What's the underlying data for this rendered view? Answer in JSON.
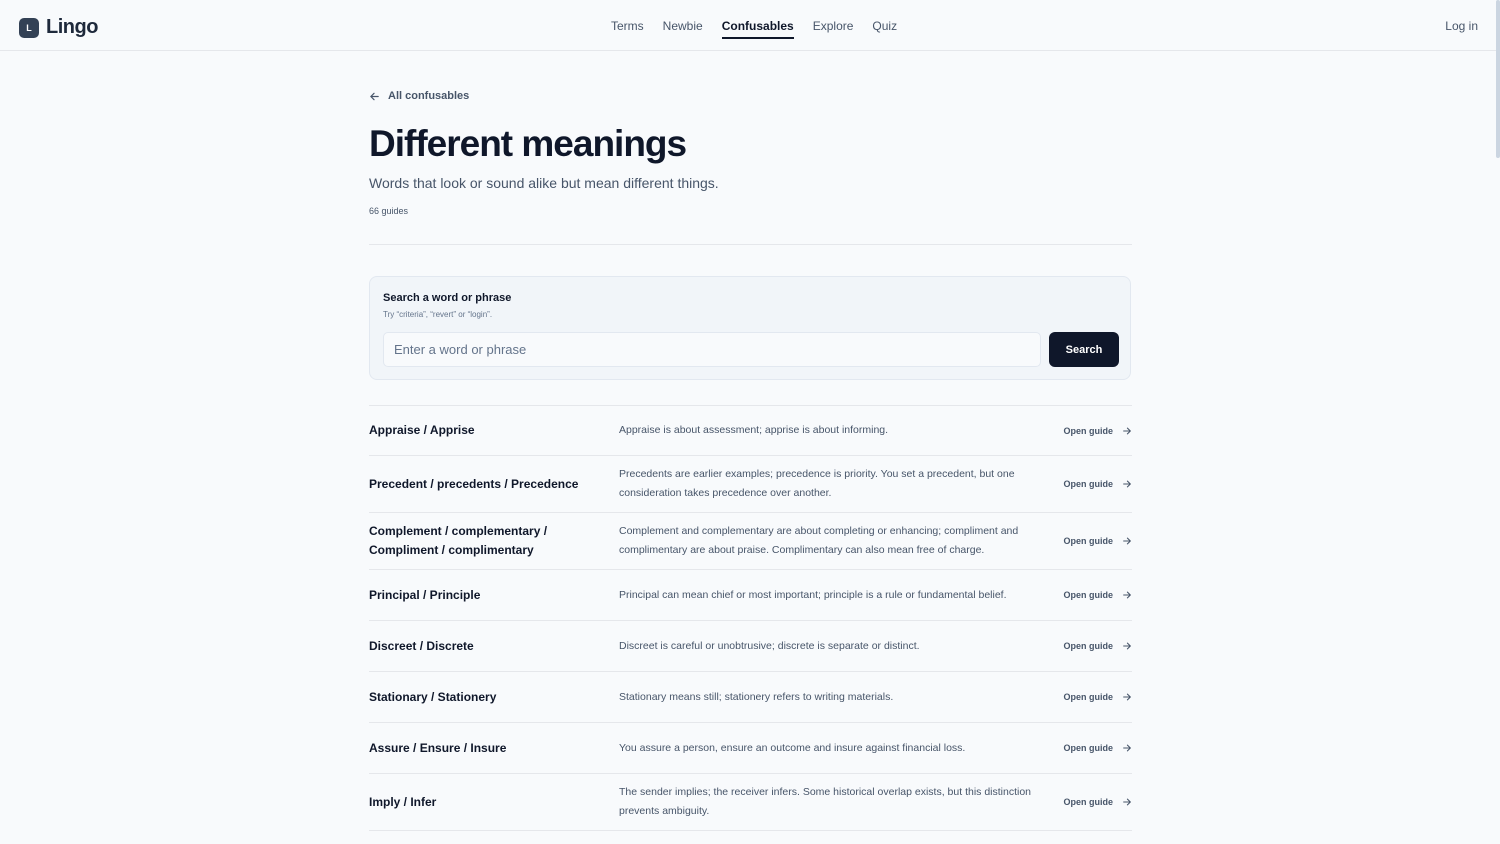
{
  "app": {
    "brand_letter": "L",
    "brand_name": "Lingo"
  },
  "nav": {
    "items": [
      {
        "label": "Terms",
        "active": false
      },
      {
        "label": "Newbie",
        "active": false
      },
      {
        "label": "Confusables",
        "active": true
      },
      {
        "label": "Explore",
        "active": false
      },
      {
        "label": "Quiz",
        "active": false
      }
    ],
    "login": "Log in"
  },
  "page": {
    "back_label": "All confusables",
    "title": "Different meanings",
    "subtitle": "Words that look or sound alike but mean different things.",
    "count": "66 guides"
  },
  "search": {
    "label": "Search a word or phrase",
    "hint": "Try “criteria”, “revert” or “login”.",
    "placeholder": "Enter a word or phrase",
    "value": "",
    "button": "Search"
  },
  "link_label": "Open guide",
  "guides": [
    {
      "title": "Appraise / Apprise",
      "desc": "Appraise is about assessment; apprise is about informing."
    },
    {
      "title": "Precedent / precedents / Precedence",
      "desc": "Precedents are earlier examples; precedence is priority. You set a precedent, but one consideration takes precedence over another."
    },
    {
      "title": "Complement / complementary / Compliment / complimentary",
      "desc": "Complement and complementary are about completing or enhancing; compliment and complimentary are about praise. Complimentary can also mean free of charge."
    },
    {
      "title": "Principal / Principle",
      "desc": "Principal can mean chief or most important; principle is a rule or fundamental belief."
    },
    {
      "title": "Discreet / Discrete",
      "desc": "Discreet is careful or unobtrusive; discrete is separate or distinct."
    },
    {
      "title": "Stationary / Stationery",
      "desc": "Stationary means still; stationery refers to writing materials."
    },
    {
      "title": "Assure / Ensure / Insure",
      "desc": "You assure a person, ensure an outcome and insure against financial loss."
    },
    {
      "title": "Imply / Infer",
      "desc": "The sender implies; the receiver infers. Some historical overlap exists, but this distinction prevents ambiguity."
    }
  ]
}
